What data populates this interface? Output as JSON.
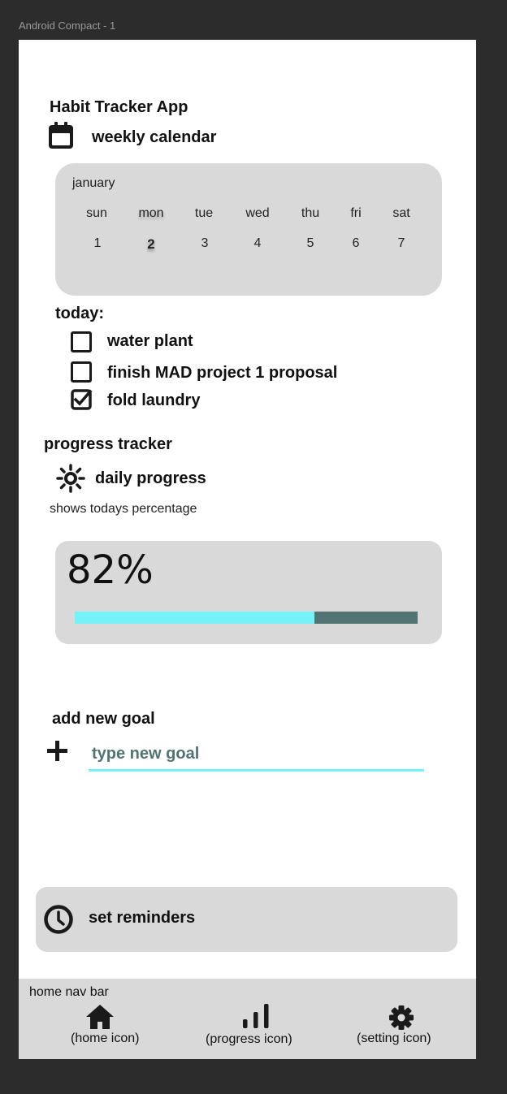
{
  "frame": {
    "label": "Android Compact - 1"
  },
  "header": {
    "title": "Habit Tracker App"
  },
  "calendar": {
    "heading": "weekly calendar",
    "icon": "calendar-icon",
    "month": "january",
    "days": [
      {
        "name": "sun",
        "date": "1"
      },
      {
        "name": "mon",
        "date": "2"
      },
      {
        "name": "tue",
        "date": "3"
      },
      {
        "name": "wed",
        "date": "4"
      },
      {
        "name": "thu",
        "date": "5"
      },
      {
        "name": "fri",
        "date": "6"
      },
      {
        "name": "sat",
        "date": "7"
      }
    ],
    "selected_date": "2"
  },
  "today": {
    "heading": "today:",
    "tasks": [
      {
        "label": "water plant",
        "checked": false
      },
      {
        "label": "finish MAD project 1 proposal",
        "checked": false
      },
      {
        "label": "fold laundry",
        "checked": true
      }
    ]
  },
  "progress": {
    "heading": "progress tracker",
    "icon": "sun-icon",
    "subheading": "daily progress",
    "description": "shows todays percentage",
    "value_text": "82%",
    "fill_percent": 70,
    "fill_color": "#74f2f8",
    "track_color": "#527373"
  },
  "goal": {
    "heading": "add new goal",
    "icon": "plus-icon",
    "input_placeholder": "type new goal",
    "underline_color": "#74f2f8"
  },
  "reminders": {
    "icon": "clock-icon",
    "label": "set reminders"
  },
  "navbar": {
    "label": "home nav bar",
    "items": [
      {
        "icon": "home-icon",
        "label": "(home icon)"
      },
      {
        "icon": "bar-chart-icon",
        "label": "(progress icon)"
      },
      {
        "icon": "gear-icon",
        "label": "(setting icon)"
      }
    ]
  }
}
